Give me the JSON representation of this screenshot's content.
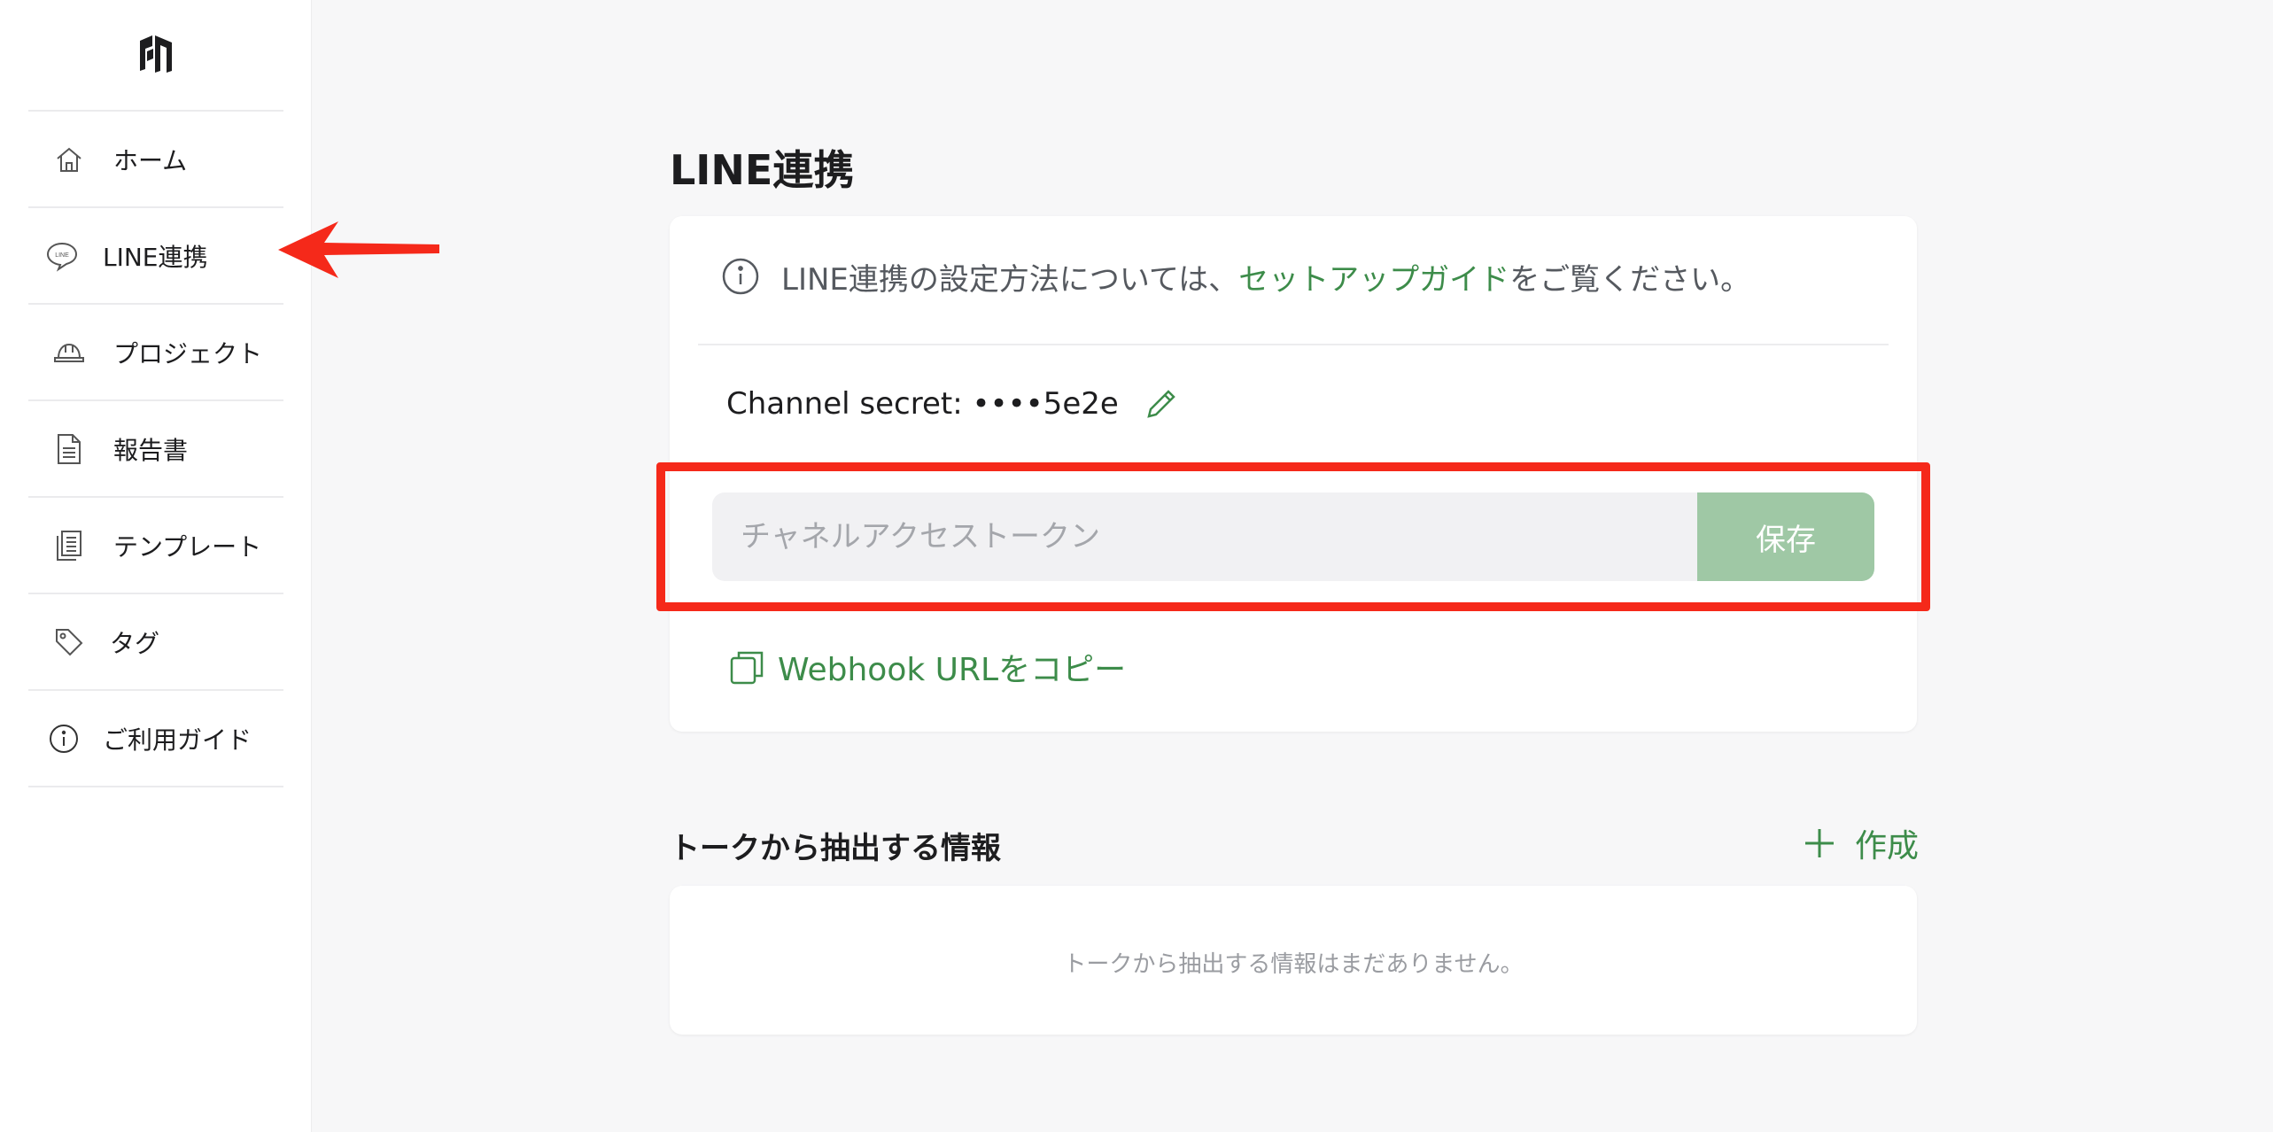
{
  "sidebar": {
    "logo_icon": "building-blocks-logo",
    "items": [
      {
        "label": "ホーム",
        "icon": "home-icon"
      },
      {
        "label": "LINE連携",
        "icon": "line-chat-icon",
        "active": true
      },
      {
        "label": "プロジェクト",
        "icon": "hard-hat-icon"
      },
      {
        "label": "報告書",
        "icon": "document-icon"
      },
      {
        "label": "テンプレート",
        "icon": "template-icon"
      },
      {
        "label": "タグ",
        "icon": "tag-icon"
      },
      {
        "label": "ご利用ガイド",
        "icon": "info-icon"
      }
    ]
  },
  "main": {
    "title": "LINE連携",
    "info": {
      "prefix": "LINE連携の設定方法については、",
      "link": "セットアップガイド",
      "suffix": "をご覧ください。"
    },
    "channel_secret": {
      "label": "Channel secret: ••••5e2e"
    },
    "token": {
      "placeholder": "チャネルアクセストークン",
      "value": "",
      "save_label": "保存"
    },
    "webhook": {
      "label": "Webhook URLをコピー"
    },
    "extract": {
      "title": "トークから抽出する情報",
      "create_label": "作成",
      "empty_text": "トークから抽出する情報はまだありません。"
    }
  },
  "colors": {
    "accent_green": "#3d8c4a",
    "save_button_bg": "#9fc8a5",
    "annotation_red": "#f5291a"
  }
}
